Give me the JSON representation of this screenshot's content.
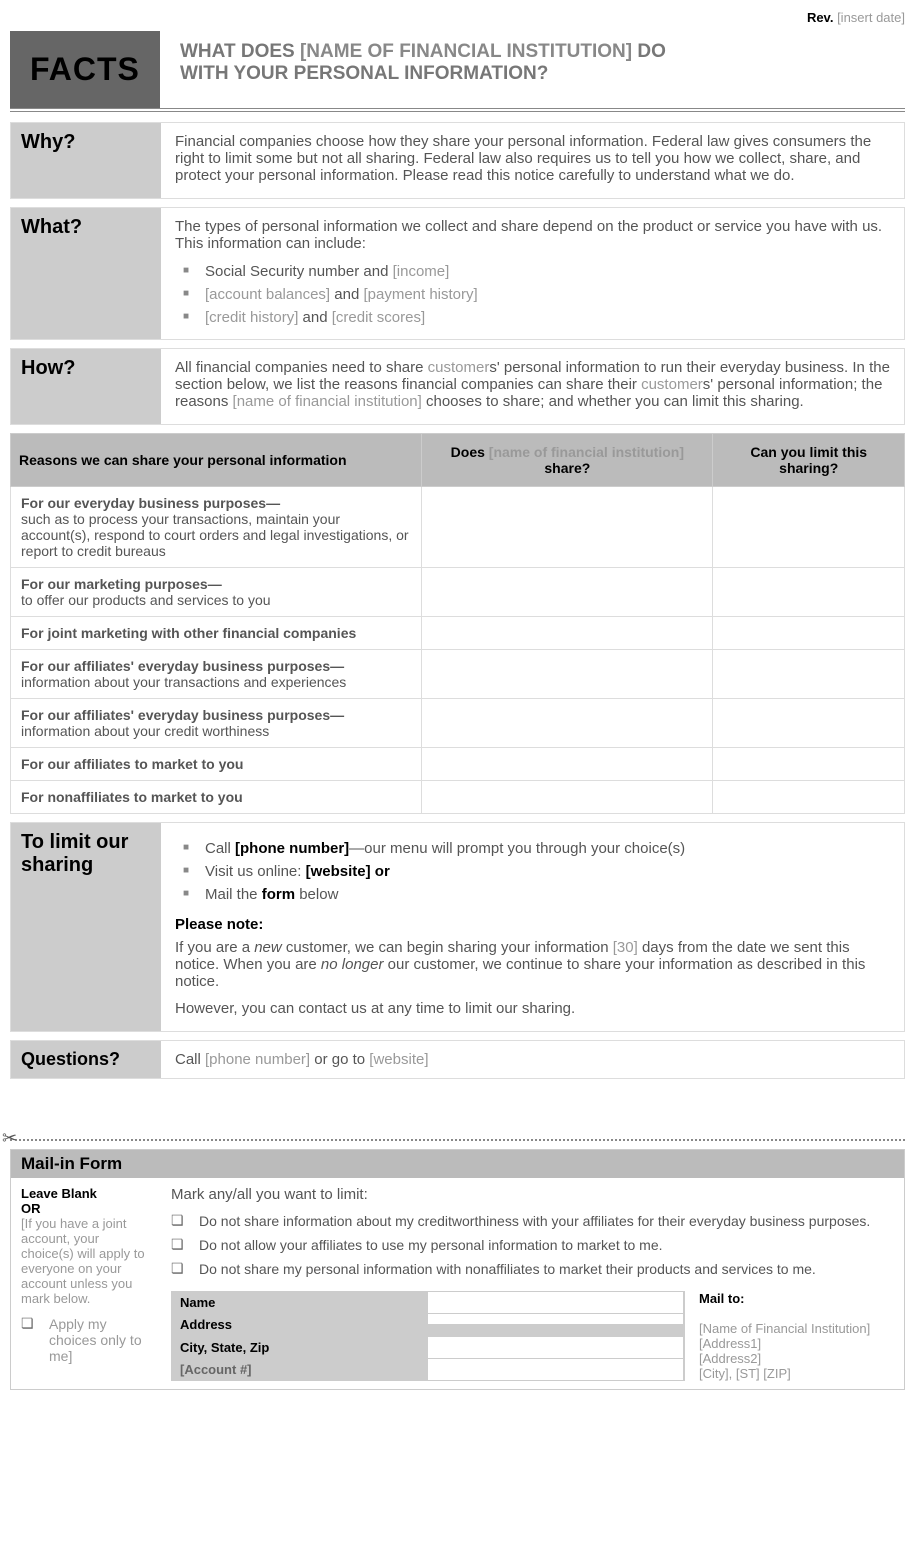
{
  "rev": {
    "label": "Rev.",
    "ph": "[insert date]"
  },
  "facts": "FACTS",
  "hq1": "WHAT DOES ",
  "hq_ph": "[NAME OF FINANCIAL INSTITUTION]",
  "hq2": " DO",
  "hq3": "WITH YOUR PERSONAL INFORMATION?",
  "why": {
    "h": "Why?",
    "t": "Financial companies choose how they share your personal information. Federal law gives consumers the right to limit some but not all sharing. Federal law also requires us to tell you how we collect, share, and protect your personal information. Please read this notice carefully to understand what we do."
  },
  "what": {
    "h": "What?",
    "t": "The types of personal information we collect and share depend on the product or service you have with us. This information can include:",
    "b1a": "Social Security number and ",
    "b1b": "[income]",
    "b2a": "[account balances]",
    "b2b": " and ",
    "b2c": "[payment history]",
    "b3a": "[credit history]",
    "b3b": " and ",
    "b3c": "[credit scores]"
  },
  "how": {
    "h": "How?",
    "t1": "All financial companies need to share ",
    "t1ph": "customer",
    "t2": "s' personal information to run their everyday business. In the section below, we list the reasons financial companies can share their ",
    "t2ph": "customer",
    "t3": "s' personal information; the reasons ",
    "t3ph": "[name of financial institution]",
    "t4": " chooses to share; and whether you can limit this sharing."
  },
  "th1": "Reasons we can share your personal information",
  "th2a": "Does ",
  "th2b": "[name of financial institution]",
  "th2c": " share?",
  "th3": "Can you limit this sharing?",
  "r1b": "For our everyday business purposes—",
  "r1t": "such as to process your transactions, maintain your account(s), respond to court orders and legal investigations, or report to credit bureaus",
  "r2b": "For our marketing purposes—",
  "r2t": "to offer our products and services to you",
  "r3b": "For joint marketing with other financial companies",
  "r4b": "For our affiliates' everyday business purposes—",
  "r4t": "information about your transactions and experiences",
  "r5b": "For our affiliates' everyday business purposes—",
  "r5t": "information about your credit worthiness",
  "r6b": "For our affiliates to market to you",
  "r7b": "For nonaffiliates to market to you",
  "lim": {
    "h": "To limit our sharing",
    "b1a": "Call ",
    "b1b": "[phone number]",
    "b1c": "—our menu will prompt you through your choice(s)",
    "b2a": "Visit us online: ",
    "b2b": "[website] or",
    "b3a": "Mail the ",
    "b3b": "form",
    "b3c": " below",
    "pn": "Please note:",
    "p1a": "If you are a ",
    "p1b": "new",
    "p1c": " customer, we can begin sharing your information ",
    "p1d": "[30]",
    "p1e": " days from the date we sent this notice. When you are ",
    "p1f": "no longer",
    "p1g": " our customer, we continue to share your information as described in this notice.",
    "p2": "However, you can contact us at any time to limit our sharing."
  },
  "q": {
    "h": "Questions?",
    "t1": "Call ",
    "t1b": "[phone number]",
    "t2": " or go to ",
    "t2b": "[website]"
  },
  "mif": {
    "h": "Mail-in Form",
    "lb": "Leave Blank",
    "or": "OR",
    "lt": "[If you have a joint account, your choice(s) will apply to everyone on your account unless you mark below.",
    "cb": "Apply my choices only to me]",
    "mk": "Mark any/all you want to limit:",
    "o1": "Do not share information about my creditworthiness with your affiliates for their everyday business purposes.",
    "o2": "Do not allow your affiliates to use my personal information to market to me.",
    "o3": "Do not share my personal information with nonaffiliates to market their products and services to me.",
    "f1": "Name",
    "f2": "Address",
    "f3": "City, State,  Zip",
    "f4": "[Account #]",
    "mt": "Mail to:",
    "m1": "[Name of Financial Institution]",
    "m2": "[Address1]",
    "m3": "[Address2]",
    "m4": "[City], [ST] [ZIP]"
  }
}
